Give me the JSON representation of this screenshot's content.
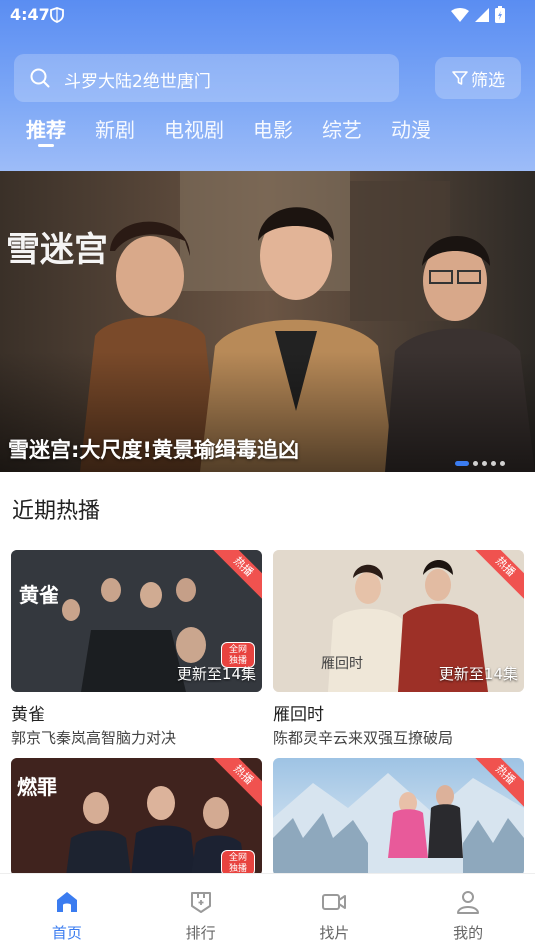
{
  "status": {
    "time": "4:47"
  },
  "search": {
    "query": "斗罗大陆2绝世唐门"
  },
  "filter": {
    "label": "筛选"
  },
  "tabs": [
    "推荐",
    "新剧",
    "电视剧",
    "电影",
    "综艺",
    "动漫"
  ],
  "banner": {
    "title": "雪迷宫:大尺度!黄景瑜缉毒追凶",
    "slide_count": 5,
    "active_slide": 1
  },
  "section": {
    "title": "近期热播"
  },
  "cards": [
    {
      "name": "黄雀",
      "desc": "郭京飞秦岚高智脑力对决",
      "update": "更新至14集",
      "badge": "热播",
      "poster_text": "黄雀",
      "tag": "全网独播"
    },
    {
      "name": "雁回时",
      "desc": "陈都灵辛云来双强互撩破局",
      "update": "更新至14集",
      "badge": "热播",
      "poster_text": "雁回时"
    },
    {
      "name": "",
      "desc": "",
      "update": "",
      "badge": "热播",
      "poster_text": "燃罪",
      "tag": "全网独播"
    },
    {
      "name": "",
      "desc": "",
      "update": "",
      "badge": "热播"
    }
  ],
  "nav": [
    {
      "label": "首页",
      "icon": "home-icon",
      "active": true
    },
    {
      "label": "排行",
      "icon": "ranking-icon",
      "active": false
    },
    {
      "label": "找片",
      "icon": "video-camera-icon",
      "active": false
    },
    {
      "label": "我的",
      "icon": "profile-icon",
      "active": false
    }
  ],
  "colors": {
    "accent": "#3b7cf0",
    "header_top": "#5a8df2",
    "hot_badge": "#f0524f"
  }
}
